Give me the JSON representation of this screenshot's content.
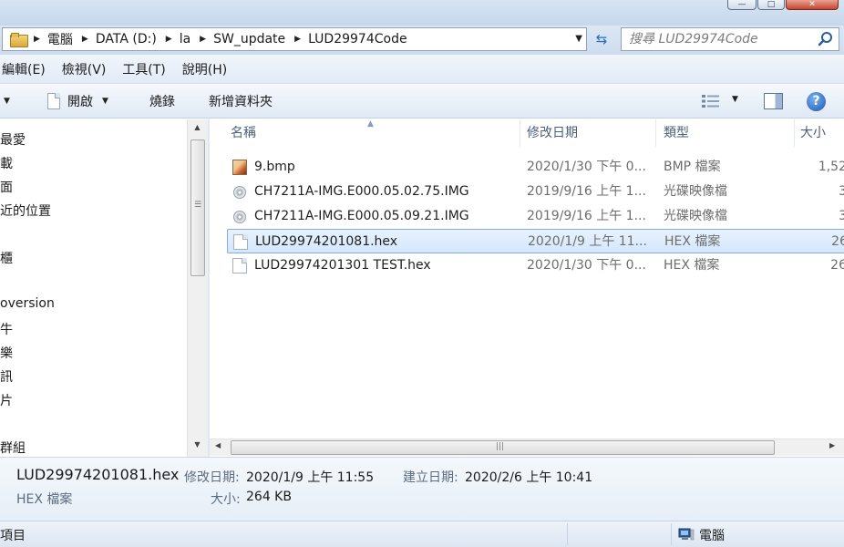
{
  "window": {
    "min_glyph": "—",
    "max_glyph": "□",
    "close_glyph": "✕"
  },
  "address": {
    "crumbs": [
      "電腦",
      "DATA (D:)",
      "la",
      "SW_update",
      "LUD29974Code"
    ],
    "search_placeholder": "搜尋 LUD29974Code"
  },
  "menu": [
    "編輯(E)",
    "檢視(V)",
    "工具(T)",
    "說明(H)"
  ],
  "commands": {
    "open": "開啟",
    "burn": "燒錄",
    "new_folder": "新增資料夾"
  },
  "nav_items": [
    "最愛",
    "載",
    "面",
    "近的位置",
    "櫃",
    "oversion",
    "牛",
    "樂",
    "訊",
    "片",
    "群組"
  ],
  "columns": {
    "name": "名稱",
    "date": "修改日期",
    "type": "類型",
    "size": "大小"
  },
  "files": [
    {
      "icon": "bmp-icon",
      "name": "9.bmp",
      "date": "2020/1/30 下午 0...",
      "type": "BMP 檔案",
      "size": "1,52"
    },
    {
      "icon": "disc-image-icon",
      "name": "CH7211A-IMG.E000.05.02.75.IMG",
      "date": "2019/9/16 上午 1...",
      "type": "光碟映像檔",
      "size": "3"
    },
    {
      "icon": "disc-image-icon",
      "name": "CH7211A-IMG.E000.05.09.21.IMG",
      "date": "2019/9/16 上午 1...",
      "type": "光碟映像檔",
      "size": "3"
    },
    {
      "icon": "hex-file-icon",
      "name": "LUD29974201081.hex",
      "date": "2020/1/9 上午 11...",
      "type": "HEX 檔案",
      "size": "26",
      "selected": true
    },
    {
      "icon": "hex-file-icon",
      "name": "LUD29974201301 TEST.hex",
      "date": "2020/1/30 下午 0...",
      "type": "HEX 檔案",
      "size": "26"
    }
  ],
  "details": {
    "name": "LUD29974201081.hex",
    "type": "HEX 檔案",
    "modified_label": "修改日期:",
    "modified_value": "2020/1/9 上午 11:55",
    "created_label": "建立日期:",
    "created_value": "2020/2/6 上午 10:41",
    "size_label": "大小:",
    "size_value": "264 KB"
  },
  "status": {
    "left": "項目",
    "right": "電腦"
  },
  "colors": {
    "selection_bg": "#d4e7fc",
    "selection_border": "#84acdd",
    "chrome": "#dbe7f4"
  }
}
